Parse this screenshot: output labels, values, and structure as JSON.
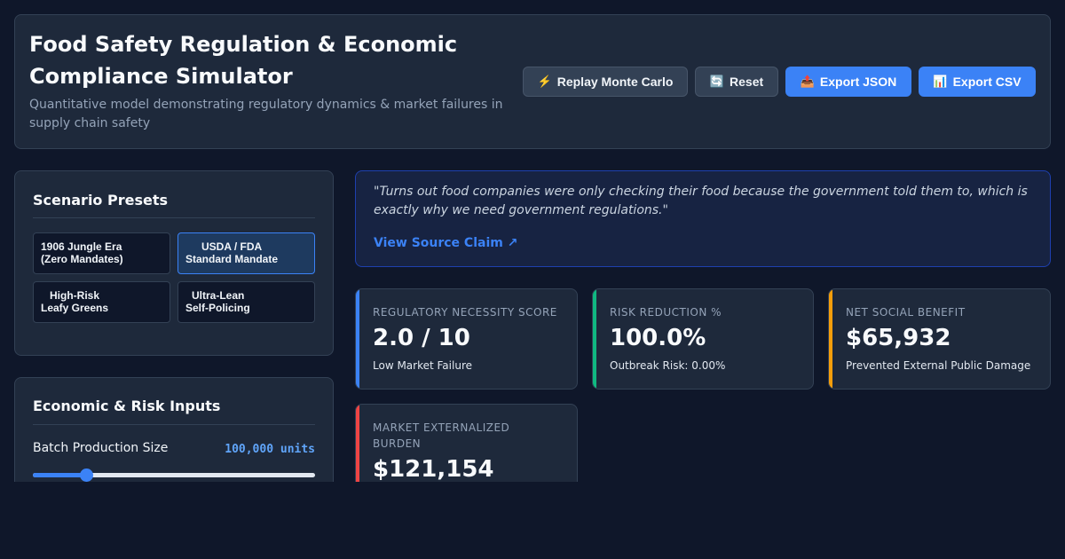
{
  "header": {
    "title": "Food Safety Regulation & Economic Compliance Simulator",
    "subtitle": "Quantitative model demonstrating regulatory dynamics & market failures in supply chain safety",
    "buttons": {
      "replay": {
        "icon": "⚡",
        "label": "Replay Monte Carlo"
      },
      "reset": {
        "icon": "🔄",
        "label": "Reset"
      },
      "export_json": {
        "icon": "📤",
        "label": "Export JSON"
      },
      "export_csv": {
        "icon": "📊",
        "label": "Export CSV"
      }
    }
  },
  "presets": {
    "title": "Scenario Presets",
    "items": [
      {
        "line1": "1906 Jungle Era",
        "line2": "(Zero Mandates)",
        "active": false
      },
      {
        "line1": "USDA / FDA",
        "line2": "Standard Mandate",
        "active": true
      },
      {
        "line1": "High-Risk",
        "line2": "Leafy Greens",
        "active": false
      },
      {
        "line1": "Ultra-Lean",
        "line2": "Self-Policing",
        "active": false
      }
    ]
  },
  "inputs": {
    "title": "Economic & Risk Inputs",
    "batch_size": {
      "label": "Batch Production Size",
      "value": "100,000 units",
      "fraction": 0.19
    }
  },
  "quote": {
    "text": "\"Turns out food companies were only checking their food because the government told them to, which is exactly why we need government regulations.\"",
    "link": "View Source Claim ↗"
  },
  "metrics": [
    {
      "label": "Regulatory Necessity Score",
      "value": "2.0 / 10",
      "sub": "Low Market Failure",
      "color": "#3b82f6"
    },
    {
      "label": "Risk Reduction %",
      "value": "100.0%",
      "sub": "Outbreak Risk: 0.00%",
      "color": "#10b981"
    },
    {
      "label": "Net Social Benefit",
      "value": "$65,932",
      "sub": "Prevented External Public Damage",
      "color": "#f59e0b"
    },
    {
      "label": "Market Externalized Burden",
      "value": "$121,154",
      "sub": "",
      "color": "#ef4444"
    }
  ]
}
